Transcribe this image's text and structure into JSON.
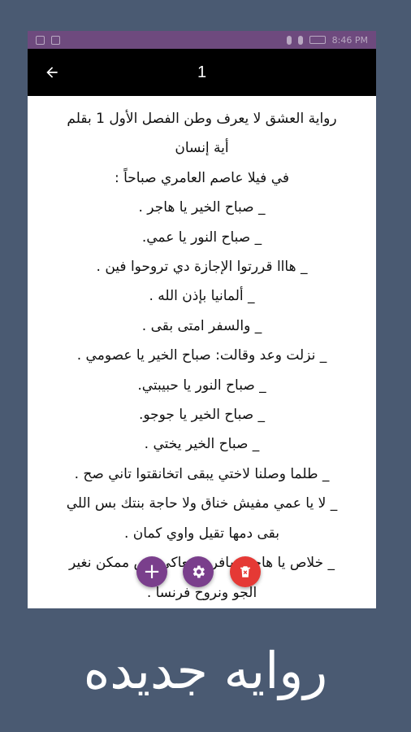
{
  "status_bar": {
    "time": "8:46 PM"
  },
  "app_bar": {
    "title": "1",
    "back_icon": "arrow-left-icon"
  },
  "content": {
    "lines": [
      "رواية العشق لا يعرف وطن الفصل الأول 1 بقلم",
      "أية إنسان",
      "في فيلا عاصم العامري صباحاً :",
      "_ صباح الخير يا هاجر .",
      "_ صباح النور يا عمي.",
      "_ هااا قررتوا الإجازة دي تروحوا فين .",
      "_ ألمانيا بإذن الله .",
      "_ والسفر امتى بقى .",
      "_ نزلت وعد وقالت: صباح الخير يا عصومي .",
      "_ صباح النور يا حبيبتي.",
      "_ صباح الخير يا جوجو.",
      "_ صباح الخير يختي .",
      "_ طلما وصلنا لاختي يبقى اتخانقتوا تاني صح .",
      "_ لا يا عمي مفيش خناق ولا حاجة بنتك بس اللي",
      "بقى دمها تقيل واوي كمان .",
      "_ خلاص يا هاجر سافري معاكي بس ممكن نغير",
      "الجو ونروح فرنسا ."
    ]
  },
  "fabs": {
    "add_label": "+"
  },
  "banner": {
    "text": "روايه جديده"
  },
  "colors": {
    "primary": "#7a3f8c",
    "danger": "#e53935",
    "background": "#4a5a72",
    "appbar": "#000000"
  }
}
